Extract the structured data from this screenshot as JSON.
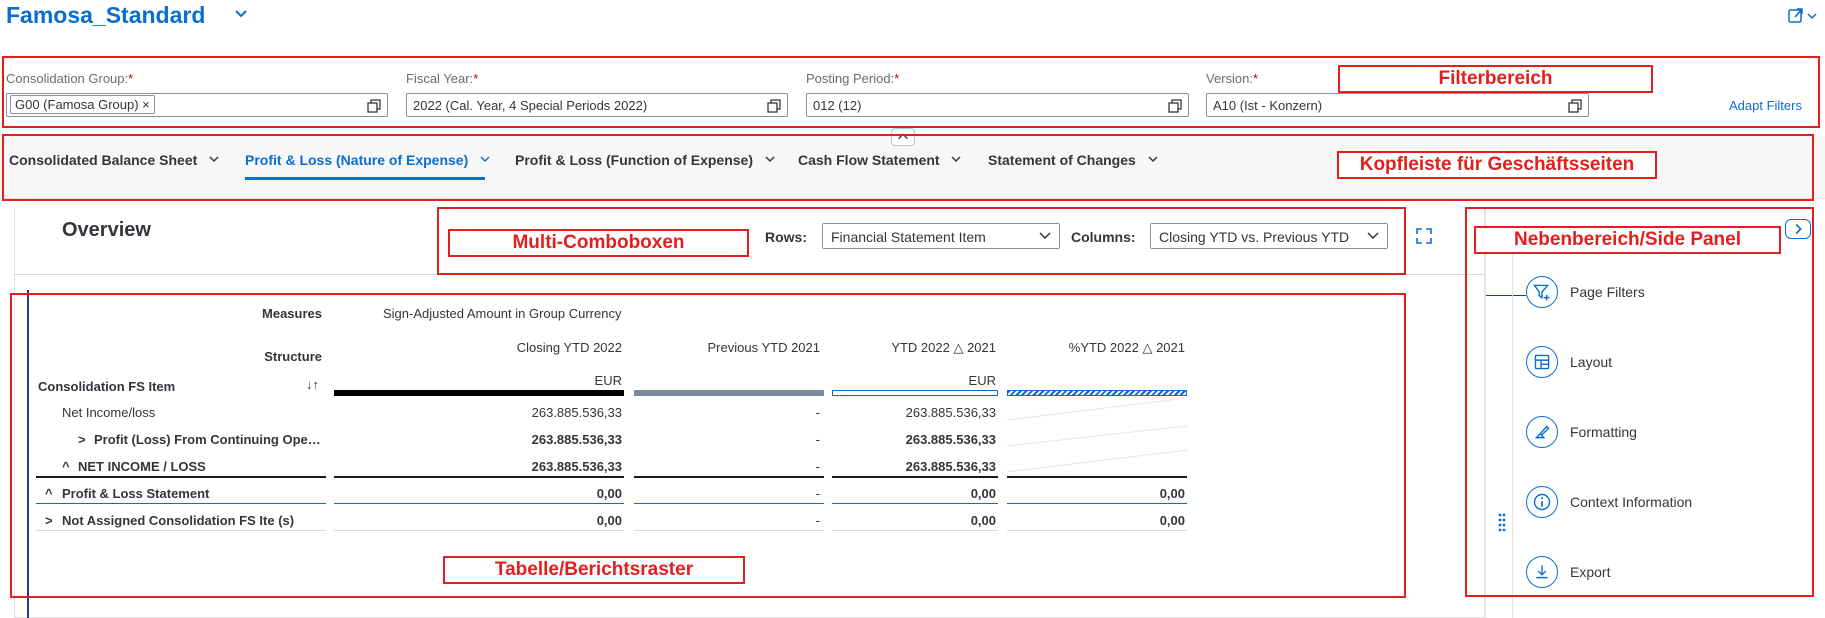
{
  "header": {
    "title": "Famosa_Standard",
    "chevron_icon": "chevron-down-icon",
    "share_icon": "share-icon"
  },
  "filters": {
    "consolidation_group": {
      "label": "Consolidation Group:",
      "required": "*",
      "token": "G00 (Famosa Group)",
      "token_remove": "×"
    },
    "fiscal_year": {
      "label": "Fiscal Year:",
      "required": "*",
      "value": "2022 (Cal. Year, 4 Special Periods 2022)"
    },
    "posting_period": {
      "label": "Posting Period:",
      "required": "*",
      "value": "012 (12)"
    },
    "version": {
      "label": "Version:",
      "required": "*",
      "value": "A10 (Ist - Konzern)"
    },
    "adapt_filters": "Adapt Filters"
  },
  "tabs": [
    {
      "label": "Consolidated Balance Sheet"
    },
    {
      "label": "Profit & Loss (Nature of Expense)"
    },
    {
      "label": "Profit & Loss (Function of Expense)"
    },
    {
      "label": "Cash Flow Statement"
    },
    {
      "label": "Statement of Changes"
    }
  ],
  "overview": {
    "title": "Overview",
    "rows_label": "Rows:",
    "rows_value": "Financial Statement Item",
    "columns_label": "Columns:",
    "columns_value": "Closing YTD vs. Previous YTD"
  },
  "table": {
    "measures_label": "Measures",
    "measures_value": "Sign-Adjusted Amount in Group Currency",
    "structure_label": "Structure",
    "row_header": "Consolidation FS Item",
    "sort_icon": "↓↑",
    "columns": [
      "Closing YTD 2022",
      "Previous YTD 2021",
      "YTD 2022 △ 2021",
      "%YTD 2022 △ 2021"
    ],
    "currency": [
      "EUR",
      "",
      "EUR",
      ""
    ],
    "rows": [
      {
        "expander": "",
        "label": "Net Income/loss",
        "values": [
          "263.885.536,33",
          "-",
          "263.885.536,33",
          ""
        ]
      },
      {
        "expander": ">",
        "label": "Profit (Loss) From Continuing Ope…",
        "values": [
          "263.885.536,33",
          "-",
          "263.885.536,33",
          ""
        ]
      },
      {
        "expander": "^",
        "label": "NET INCOME / LOSS",
        "values": [
          "263.885.536,33",
          "-",
          "263.885.536,33",
          ""
        ]
      },
      {
        "expander": "^",
        "label": "Profit & Loss Statement",
        "values": [
          "0,00",
          "-",
          "0,00",
          "0,00"
        ]
      },
      {
        "expander": ">",
        "label": "Not Assigned Consolidation FS Ite (s)",
        "values": [
          "0,00",
          "-",
          "0,00",
          "0,00"
        ]
      }
    ]
  },
  "side_panel": {
    "items": [
      {
        "label": "Page Filters",
        "icon": "filter-add-icon"
      },
      {
        "label": "Layout",
        "icon": "layout-icon"
      },
      {
        "label": "Formatting",
        "icon": "format-brush-icon"
      },
      {
        "label": "Context Information",
        "icon": "info-icon"
      },
      {
        "label": "Export",
        "icon": "download-icon"
      }
    ]
  },
  "annotations": {
    "filterbereich": "Filterbereich",
    "kopfleiste": "Kopfleiste für Geschäftsseiten",
    "multi_combo": "Multi-Comboboxen",
    "nebenbereich": "Nebenbereich/Side Panel",
    "tabelle": "Tabelle/Berichtsraster"
  },
  "colors": {
    "accent": "#0a6ed1",
    "annotation_red": "#e41e1e"
  }
}
